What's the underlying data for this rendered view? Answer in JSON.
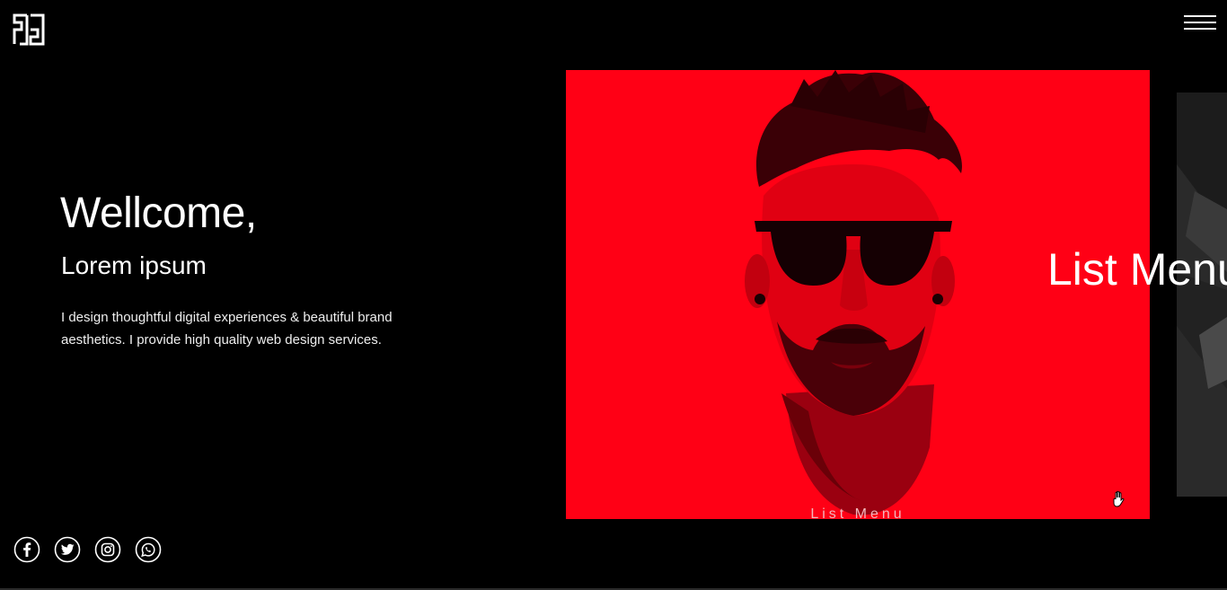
{
  "header": {
    "logo_icon": "brand-logo-icon",
    "menu_icon": "hamburger-menu-icon"
  },
  "hero": {
    "title": "Wellcome,",
    "subtitle": "Lorem ipsum",
    "description": "I design thoughtful digital experiences & beautiful brand aesthetics. I provide high quality web design services."
  },
  "slider": {
    "active_slide": {
      "caption": "List Menu",
      "background_color": "#ff0015"
    },
    "overlay_label": "List Menu",
    "next_slide_color": "#2b2b2b"
  },
  "social": [
    {
      "name": "facebook-icon"
    },
    {
      "name": "twitter-icon"
    },
    {
      "name": "instagram-icon"
    },
    {
      "name": "whatsapp-icon"
    }
  ],
  "colors": {
    "background": "#000000",
    "accent": "#ff0015",
    "text": "#ffffff"
  }
}
